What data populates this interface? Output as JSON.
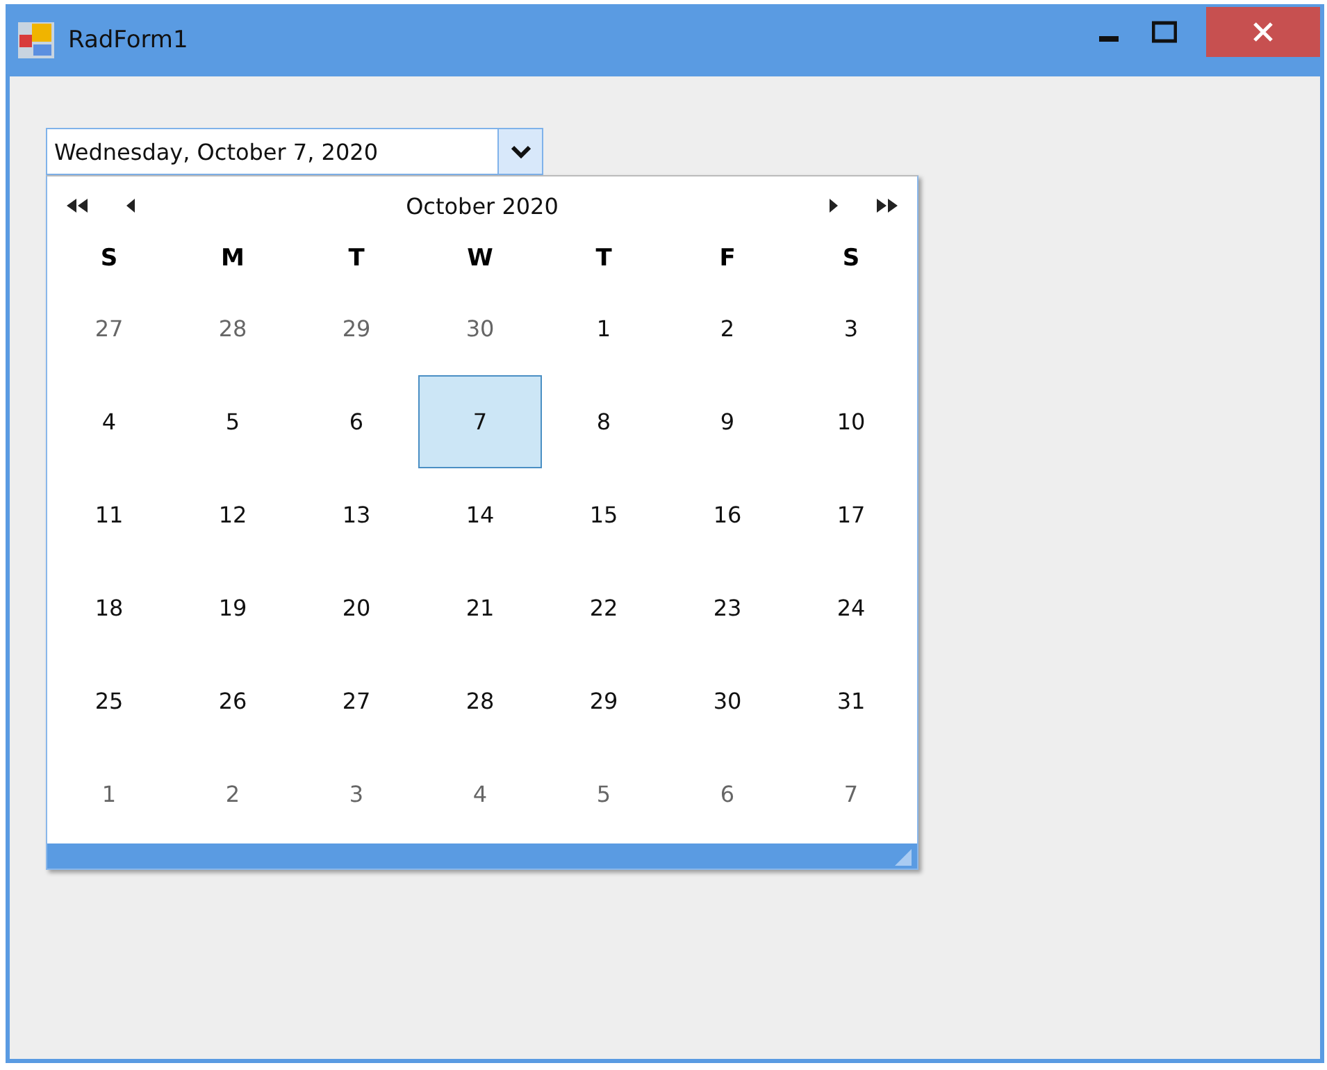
{
  "window": {
    "title": "RadForm1"
  },
  "date_field": {
    "value": "Wednesday, October 7, 2020"
  },
  "calendar": {
    "title": "October 2020",
    "weekdays": [
      "S",
      "M",
      "T",
      "W",
      "T",
      "F",
      "S"
    ],
    "weeks": [
      [
        {
          "day": "27",
          "other_month": true,
          "selected": false
        },
        {
          "day": "28",
          "other_month": true,
          "selected": false
        },
        {
          "day": "29",
          "other_month": true,
          "selected": false
        },
        {
          "day": "30",
          "other_month": true,
          "selected": false
        },
        {
          "day": "1",
          "other_month": false,
          "selected": false
        },
        {
          "day": "2",
          "other_month": false,
          "selected": false
        },
        {
          "day": "3",
          "other_month": false,
          "selected": false
        }
      ],
      [
        {
          "day": "4",
          "other_month": false,
          "selected": false
        },
        {
          "day": "5",
          "other_month": false,
          "selected": false
        },
        {
          "day": "6",
          "other_month": false,
          "selected": false
        },
        {
          "day": "7",
          "other_month": false,
          "selected": true
        },
        {
          "day": "8",
          "other_month": false,
          "selected": false
        },
        {
          "day": "9",
          "other_month": false,
          "selected": false
        },
        {
          "day": "10",
          "other_month": false,
          "selected": false
        }
      ],
      [
        {
          "day": "11",
          "other_month": false,
          "selected": false
        },
        {
          "day": "12",
          "other_month": false,
          "selected": false
        },
        {
          "day": "13",
          "other_month": false,
          "selected": false
        },
        {
          "day": "14",
          "other_month": false,
          "selected": false
        },
        {
          "day": "15",
          "other_month": false,
          "selected": false
        },
        {
          "day": "16",
          "other_month": false,
          "selected": false
        },
        {
          "day": "17",
          "other_month": false,
          "selected": false
        }
      ],
      [
        {
          "day": "18",
          "other_month": false,
          "selected": false
        },
        {
          "day": "19",
          "other_month": false,
          "selected": false
        },
        {
          "day": "20",
          "other_month": false,
          "selected": false
        },
        {
          "day": "21",
          "other_month": false,
          "selected": false
        },
        {
          "day": "22",
          "other_month": false,
          "selected": false
        },
        {
          "day": "23",
          "other_month": false,
          "selected": false
        },
        {
          "day": "24",
          "other_month": false,
          "selected": false
        }
      ],
      [
        {
          "day": "25",
          "other_month": false,
          "selected": false
        },
        {
          "day": "26",
          "other_month": false,
          "selected": false
        },
        {
          "day": "27",
          "other_month": false,
          "selected": false
        },
        {
          "day": "28",
          "other_month": false,
          "selected": false
        },
        {
          "day": "29",
          "other_month": false,
          "selected": false
        },
        {
          "day": "30",
          "other_month": false,
          "selected": false
        },
        {
          "day": "31",
          "other_month": false,
          "selected": false
        }
      ],
      [
        {
          "day": "1",
          "other_month": true,
          "selected": false
        },
        {
          "day": "2",
          "other_month": true,
          "selected": false
        },
        {
          "day": "3",
          "other_month": true,
          "selected": false
        },
        {
          "day": "4",
          "other_month": true,
          "selected": false
        },
        {
          "day": "5",
          "other_month": true,
          "selected": false
        },
        {
          "day": "6",
          "other_month": true,
          "selected": false
        },
        {
          "day": "7",
          "other_month": true,
          "selected": false
        }
      ]
    ]
  }
}
